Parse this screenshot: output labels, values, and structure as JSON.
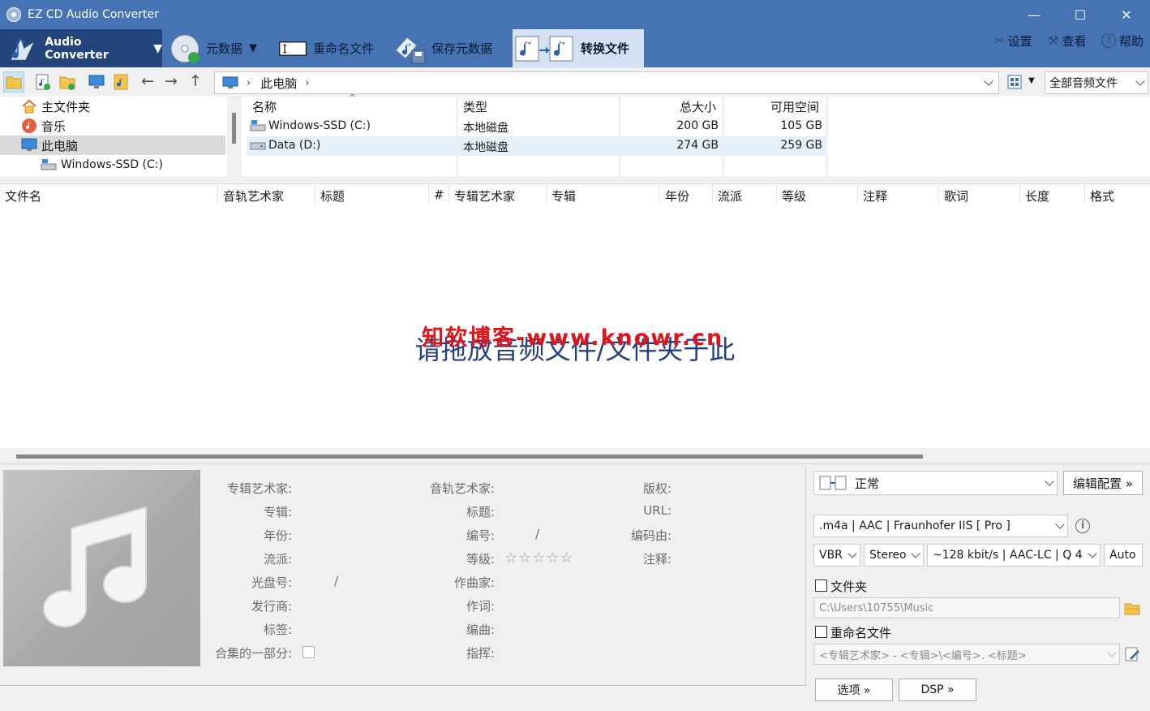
{
  "window": {
    "title": "EZ CD Audio Converter",
    "min": "—",
    "max": "☐",
    "close": "✕"
  },
  "ribbon": {
    "mode_label": "Audio Converter",
    "metadata": "元数据",
    "rename": "重命名文件",
    "save_meta": "保存元数据",
    "convert": "转换文件",
    "settings": "设置",
    "view": "查看",
    "help": "帮助"
  },
  "nav": {
    "address": "此电脑",
    "filter": "全部音频文件"
  },
  "tree": [
    {
      "label": "主文件夹",
      "icon": "home-icon"
    },
    {
      "label": "音乐",
      "icon": "music-folder-icon"
    },
    {
      "label": "此电脑",
      "icon": "computer-icon"
    },
    {
      "label": "Windows-SSD (C:)",
      "icon": "drive-icon"
    }
  ],
  "drives": {
    "headers": [
      "名称",
      "类型",
      "总大小",
      "可用空间"
    ],
    "rows": [
      {
        "name": "Windows-SSD (C:)",
        "type": "本地磁盘",
        "total": "200 GB",
        "free": "105 GB"
      },
      {
        "name": "Data (D:)",
        "type": "本地磁盘",
        "total": "274 GB",
        "free": "259 GB"
      }
    ]
  },
  "columns": [
    "文件名",
    "音轨艺术家",
    "标题",
    "#",
    "专辑艺术家",
    "专辑",
    "年份",
    "流派",
    "等级",
    "注释",
    "歌词",
    "长度",
    "格式"
  ],
  "drop_text": "请拖放音频文件/文件夹于此",
  "watermark": "知软博客-www.knowr.cn",
  "meta": {
    "col1": [
      "专辑艺术家:",
      "专辑:",
      "年份:",
      "流派:",
      "光盘号:",
      "发行商:",
      "标签:",
      "合集的一部分:"
    ],
    "col2": [
      "音轨艺术家:",
      "标题:",
      "编号:",
      "等级:",
      "作曲家:",
      "作词:",
      "编曲:",
      "指挥:"
    ],
    "col3": [
      "版权:",
      "URL:",
      "编码由:",
      "注释:"
    ],
    "slash": "/",
    "stars": "☆☆☆☆☆"
  },
  "config": {
    "profile": "正常",
    "edit_profile": "编辑配置 »",
    "format": ".m4a  |  AAC  |  Fraunhofer IIS [ Pro ]",
    "mode": "VBR",
    "channels": "Stereo",
    "quality": "~128 kbit/s | AAC-LC | Q 4",
    "auto": "Auto",
    "folder_label": "文件夹",
    "folder_path": "C:\\Users\\10755\\Music",
    "rename_label": "重命名文件",
    "rename_pattern": "<专辑艺术家> - <专辑>\\<编号>. <标题>",
    "options": "选项 »",
    "dsp": "DSP »"
  }
}
